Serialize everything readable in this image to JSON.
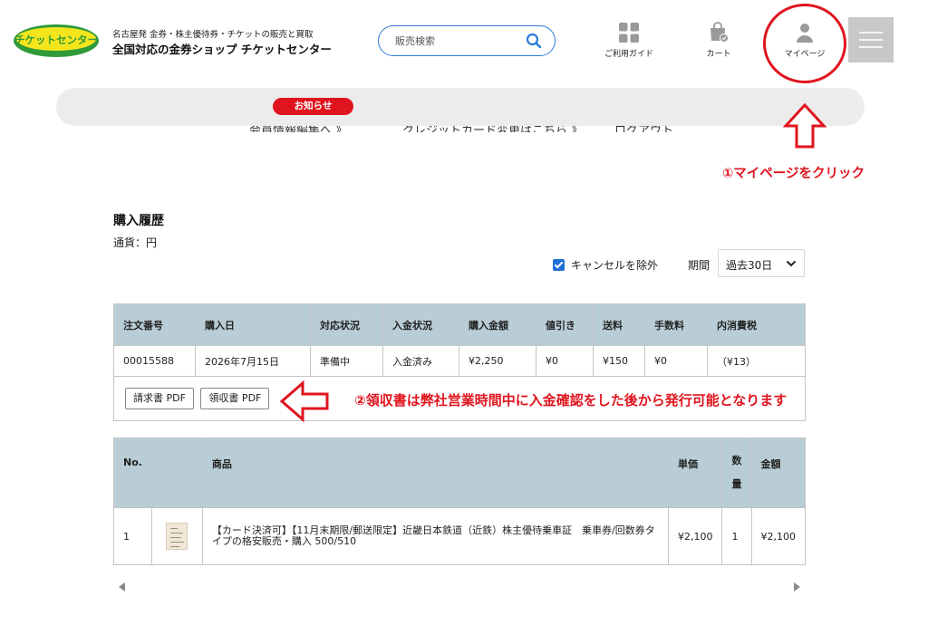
{
  "header": {
    "logo_text": "チケットセンター",
    "tagline": "名古屋発 金券・株主優待券・チケットの販売と買取",
    "shop_name": "全国対応の金券ショップ チケットセンター",
    "search_placeholder": "販売検索",
    "nav": [
      {
        "label": "ご利用ガイド",
        "icon": "guide-grid-icon"
      },
      {
        "label": "カート",
        "icon": "cart-bag-icon"
      },
      {
        "label": "マイページ",
        "icon": "user-icon"
      }
    ],
    "menu_icon": "hamburger-menu-icon"
  },
  "notice": {
    "badge": "お知らせ",
    "links": [
      "会員情報編集へ 》",
      "クレジットカード変更はこちら 》",
      "ログアウト"
    ]
  },
  "annotations": {
    "step1": "①マイページをクリック",
    "step2": "②領収書は弊社営業時間中に入金確認をした後から発行可能となります"
  },
  "history": {
    "title": "購入履歴",
    "currency": "通貨：円",
    "exclude_cancel_label": "キャンセルを除外",
    "exclude_cancel_checked": true,
    "period_label": "期間",
    "period_value": "過去30日"
  },
  "order_table": {
    "headers": [
      "注文番号",
      "購入日",
      "対応状況",
      "入金状況",
      "購入金額",
      "値引き",
      "送料",
      "手数料",
      "内消費税"
    ],
    "row": [
      "00015588",
      "2026年7月15日",
      "準備中",
      "入金済み",
      "¥2,250",
      "¥0",
      "¥150",
      "¥0",
      "（¥13）"
    ],
    "buttons": [
      "請求書 PDF",
      "領収書 PDF"
    ]
  },
  "item_table": {
    "headers": [
      "No.",
      "",
      "商品",
      "単価",
      "数量",
      "金額"
    ],
    "row": {
      "no": "1",
      "product": "【カード決済可】【11月末期限/郵送限定】近畿日本鉄道（近鉄）株主優待乗車証　乗車券/回数券タイプの格安販売・購入 500/510",
      "unit_price": "¥2,100",
      "qty": "1",
      "amount": "¥2,100"
    }
  },
  "colors": {
    "accent_red": "#e0141e",
    "table_header": "#b9cdd6",
    "search_border": "#2a7bd8",
    "checkbox_blue": "#1e6fd6"
  }
}
